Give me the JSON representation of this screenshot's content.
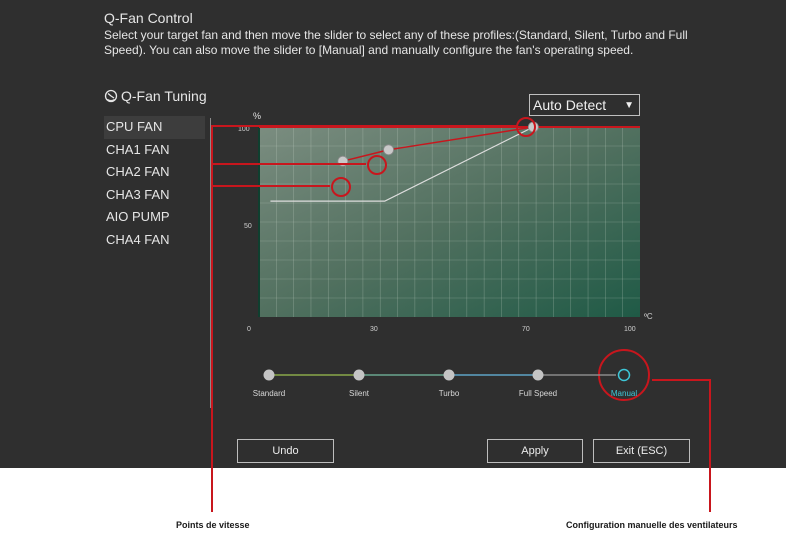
{
  "window": {
    "title": "Q-Fan Control",
    "description": "Select your target fan and then move the slider to select any of these profiles:(Standard, Silent, Turbo and Full Speed). You can also move the slider to [Manual] and manually configure the fan's operating speed."
  },
  "tuning": {
    "label": "Q-Fan Tuning",
    "icon": "fan-gauge-icon"
  },
  "fans": [
    {
      "label": "CPU FAN",
      "selected": true
    },
    {
      "label": "CHA1 FAN"
    },
    {
      "label": "CHA2 FAN"
    },
    {
      "label": "CHA3 FAN"
    },
    {
      "label": "AIO PUMP"
    },
    {
      "label": "CHA4 FAN"
    }
  ],
  "detect": {
    "value": "Auto Detect",
    "icon": "chevron-down-icon"
  },
  "graph": {
    "y_unit": "%",
    "x_unit": "ºC",
    "y_ticks": [
      "100",
      "50"
    ],
    "x_ticks": [
      "0",
      "30",
      "70",
      "100"
    ],
    "manual_curve": [
      {
        "temp": 22,
        "speed": 82
      },
      {
        "temp": 34,
        "speed": 88
      },
      {
        "temp": 72,
        "speed": 100
      }
    ],
    "reference_curve": [
      {
        "temp": 3,
        "speed": 61
      },
      {
        "temp": 33,
        "speed": 61
      },
      {
        "temp": 72,
        "speed": 100
      },
      {
        "temp": 100,
        "speed": 100
      }
    ]
  },
  "profiles": {
    "items": [
      "Standard",
      "Silent",
      "Turbo",
      "Full Speed",
      "Manual"
    ],
    "selected": "Manual"
  },
  "buttons": {
    "undo": "Undo",
    "apply": "Apply",
    "exit": "Exit (ESC)"
  },
  "captions": {
    "left": "Points de vitesse",
    "right": "Configuration manuelle des ventilateurs"
  },
  "colors": {
    "annotation": "#c8161d",
    "manual_active": "#3ec7d8",
    "grid_fill": "#2b5244"
  }
}
